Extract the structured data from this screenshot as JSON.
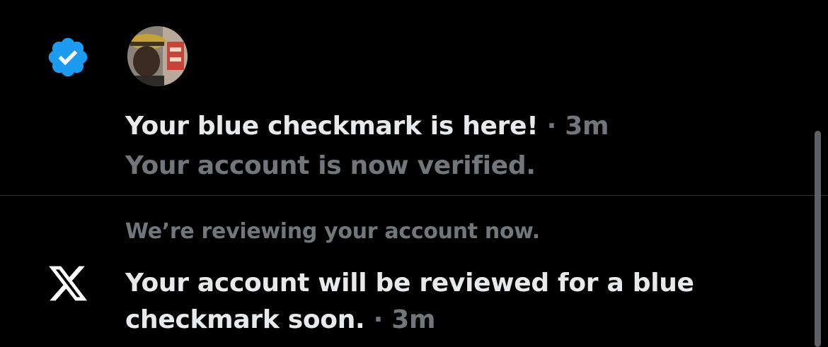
{
  "notifications": [
    {
      "icon": "verified-badge-icon",
      "icon_color": "#1d9bf0",
      "title": "Your blue checkmark is here!",
      "separator": "·",
      "time": "3m",
      "body": "Your account is now verified."
    },
    {
      "icon": "x-logo-icon",
      "subtitle": "We’re reviewing your account now.",
      "title": "Your account will be reviewed for a blue checkmark soon.",
      "separator": "·",
      "time": "3m"
    }
  ],
  "colors": {
    "background": "#000000",
    "primary_text": "#e7e9ea",
    "secondary_text": "#71767b",
    "divider": "#2f3336",
    "accent": "#1d9bf0"
  }
}
